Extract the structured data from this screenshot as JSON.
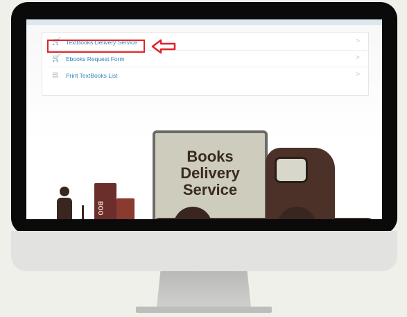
{
  "menu": {
    "items": [
      {
        "label": "TextBooks Delivery Service",
        "icon": "cart-icon",
        "highlighted": true
      },
      {
        "label": "Ebooks Request Form",
        "icon": "cart-icon"
      },
      {
        "label": "Print TextBooks List",
        "icon": "document-icon"
      }
    ]
  },
  "illustration": {
    "truck_text": [
      "Books",
      "Delivery",
      "Service"
    ],
    "stack_label": "BOO"
  },
  "colors": {
    "highlight_border": "#e0212a",
    "link": "#2f84b8",
    "truck_dark": "#4b3127"
  }
}
